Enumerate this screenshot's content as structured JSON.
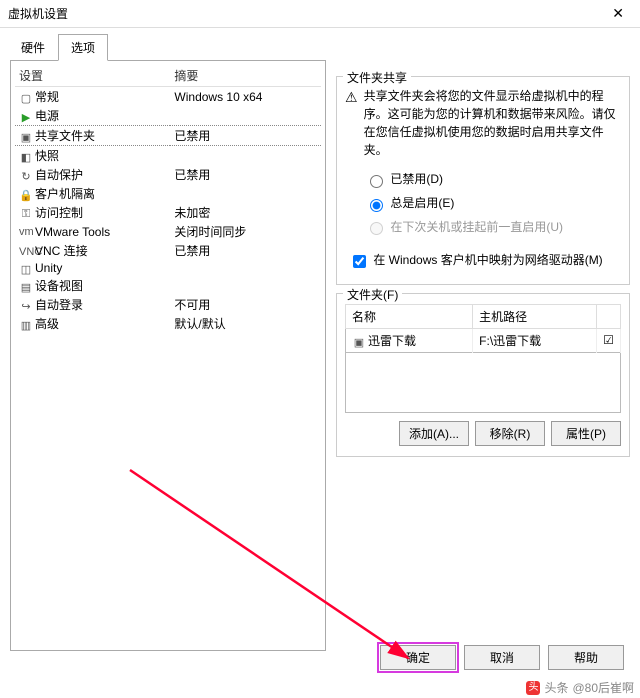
{
  "titlebar": {
    "title": "虚拟机设置"
  },
  "tabs": {
    "hardware": "硬件",
    "options": "选项"
  },
  "settings": {
    "header_device": "设置",
    "header_summary": "摘要",
    "rows": [
      {
        "icon": "gear-icon",
        "name": "常规",
        "summary": "Windows 10 x64",
        "selected": false
      },
      {
        "icon": "play-icon",
        "name": "电源",
        "summary": "",
        "selected": false,
        "green": true
      },
      {
        "icon": "folder-icon",
        "name": "共享文件夹",
        "summary": "已禁用",
        "selected": true
      },
      {
        "icon": "camera-icon",
        "name": "快照",
        "summary": "",
        "selected": false
      },
      {
        "icon": "shield-icon",
        "name": "自动保护",
        "summary": "已禁用",
        "selected": false
      },
      {
        "icon": "lock-icon",
        "name": "客户机隔离",
        "summary": "",
        "selected": false
      },
      {
        "icon": "key-icon",
        "name": "访问控制",
        "summary": "未加密",
        "selected": false
      },
      {
        "icon": "vmware-icon",
        "name": "VMware Tools",
        "summary": "关闭时间同步",
        "selected": false
      },
      {
        "icon": "vnc-icon",
        "name": "VNC 连接",
        "summary": "已禁用",
        "selected": false
      },
      {
        "icon": "unity-icon",
        "name": "Unity",
        "summary": "",
        "selected": false
      },
      {
        "icon": "device-icon",
        "name": "设备视图",
        "summary": "",
        "selected": false
      },
      {
        "icon": "login-icon",
        "name": "自动登录",
        "summary": "不可用",
        "selected": false
      },
      {
        "icon": "advanced-icon",
        "name": "高级",
        "summary": "默认/默认",
        "selected": false
      }
    ]
  },
  "share": {
    "group_title": "文件夹共享",
    "warning_text": "共享文件夹会将您的文件显示给虚拟机中的程序。这可能为您的计算机和数据带来风险。请仅在您信任虚拟机使用您的数据时启用共享文件夹。",
    "opt_disabled": "已禁用(D)",
    "opt_always": "总是启用(E)",
    "opt_until": "在下次关机或挂起前一直启用(U)",
    "map_drive": "在 Windows 客户机中映射为网络驱动器(M)"
  },
  "folders": {
    "group_title": "文件夹(F)",
    "col_name": "名称",
    "col_path": "主机路径",
    "rows": [
      {
        "name": "迅雷下载",
        "path": "F:\\迅雷下载",
        "checked": true
      }
    ],
    "btn_add": "添加(A)...",
    "btn_remove": "移除(R)",
    "btn_props": "属性(P)"
  },
  "footer": {
    "ok": "确定",
    "cancel": "取消",
    "help": "帮助"
  },
  "watermark": {
    "prefix": "头条",
    "handle": "@80后崔啊"
  }
}
